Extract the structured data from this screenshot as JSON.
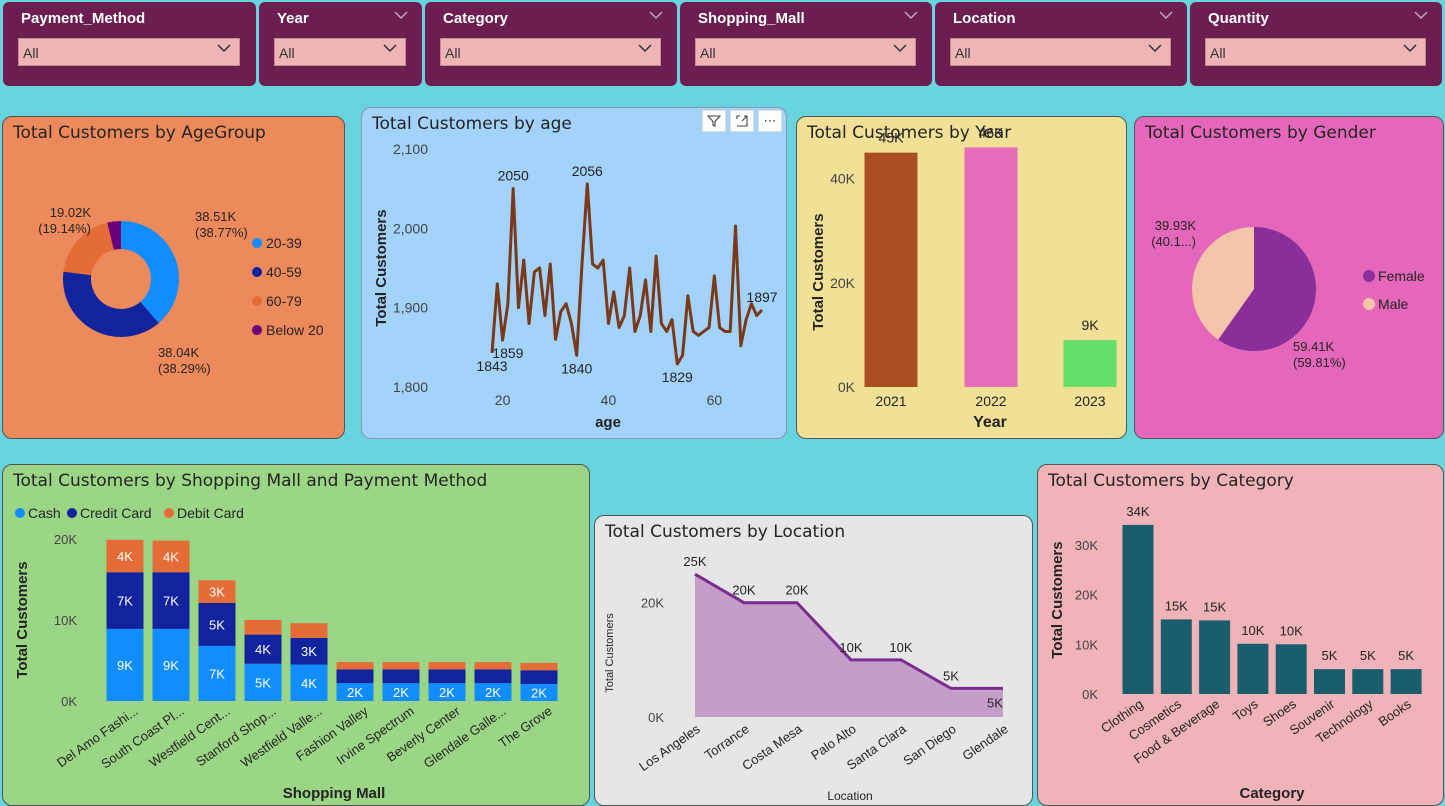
{
  "slicers": [
    {
      "title": "Payment_Method",
      "value": "All"
    },
    {
      "title": "Year",
      "value": "All"
    },
    {
      "title": "Category",
      "value": "All"
    },
    {
      "title": "Shopping_Mall",
      "value": "All"
    },
    {
      "title": "Location",
      "value": "All"
    },
    {
      "title": "Quantity",
      "value": "All"
    }
  ],
  "visual_header": {
    "filter_icon": "filter-icon",
    "focus_icon": "focus-mode-icon",
    "more_icon": "more-options-icon",
    "more_glyph": "⋯"
  },
  "chart_data": [
    {
      "id": "agegroup",
      "type": "pie",
      "title": "Total Customers by AgeGroup",
      "donut": true,
      "categories": [
        "20-39",
        "40-59",
        "60-79",
        "Below 20"
      ],
      "values": [
        38510,
        38040,
        19020,
        3800
      ],
      "colors": [
        "#118dff",
        "#12239e",
        "#e66c37",
        "#6b007b"
      ],
      "labels": [
        {
          "v": "38.51K",
          "p": "(38.77%)"
        },
        {
          "v": "38.04K",
          "p": "(38.29%)"
        },
        {
          "v": "19.02K",
          "p": "(19.14%)"
        }
      ],
      "legend_position": "right"
    },
    {
      "id": "age",
      "type": "line",
      "title": "Total Customers by age",
      "xlabel": "age",
      "ylabel": "Total Customers",
      "x": [
        18,
        19,
        20,
        21,
        22,
        23,
        24,
        25,
        26,
        27,
        28,
        29,
        30,
        31,
        32,
        33,
        34,
        35,
        36,
        37,
        38,
        39,
        40,
        41,
        42,
        43,
        44,
        45,
        46,
        47,
        48,
        49,
        50,
        51,
        52,
        53,
        54,
        55,
        56,
        57,
        58,
        59,
        60,
        61,
        62,
        63,
        64,
        65,
        66,
        67,
        68,
        69
      ],
      "y": [
        1843,
        1930,
        1859,
        1905,
        2050,
        1900,
        1960,
        1880,
        1945,
        1950,
        1890,
        1955,
        1860,
        1895,
        1905,
        1880,
        1840,
        1955,
        2056,
        1955,
        1950,
        1960,
        1880,
        1920,
        1875,
        1890,
        1950,
        1870,
        1890,
        1935,
        1870,
        1965,
        1880,
        1870,
        1885,
        1829,
        1840,
        1915,
        1870,
        1865,
        1870,
        1875,
        1940,
        1875,
        1870,
        1870,
        2003,
        1852,
        1885,
        1905,
        1890,
        1897
      ],
      "xticks": [
        20,
        40,
        60
      ],
      "yticks": [
        1800,
        1900,
        2000,
        2100
      ],
      "ytick_labels": [
        "1,800",
        "1,900",
        "2,000",
        "2,100"
      ],
      "ylim": [
        1800,
        2100
      ],
      "color": "#7a3a1a",
      "annotations": [
        {
          "x": 18,
          "y": 1843,
          "label": "1843",
          "pos": "below"
        },
        {
          "x": 22,
          "y": 2050,
          "label": "2050",
          "pos": "above"
        },
        {
          "x": 21,
          "y": 1859,
          "label": "1859",
          "pos": "below"
        },
        {
          "x": 34,
          "y": 1840,
          "label": "1840",
          "pos": "below"
        },
        {
          "x": 36,
          "y": 2056,
          "label": "2056",
          "pos": "above"
        },
        {
          "x": 53,
          "y": 1829,
          "label": "1829",
          "pos": "below"
        },
        {
          "x": 69,
          "y": 1897,
          "label": "1897",
          "pos": "above"
        }
      ]
    },
    {
      "id": "year",
      "type": "bar",
      "title": "Total Customers by Year",
      "xlabel": "Year",
      "ylabel": "Total Customers",
      "categories": [
        "2021",
        "2022",
        "2023"
      ],
      "values": [
        45000,
        46000,
        9000
      ],
      "value_labels": [
        "45K",
        "46K",
        "9K"
      ],
      "colors": [
        "#a94f22",
        "#e66bba",
        "#66de6a"
      ],
      "yticks": [
        0,
        20000,
        40000
      ],
      "ytick_labels": [
        "0K",
        "20K",
        "40K"
      ],
      "ylim": [
        0,
        48000
      ]
    },
    {
      "id": "gender",
      "type": "pie",
      "title": "Total Customers by Gender",
      "categories": [
        "Female",
        "Male"
      ],
      "values": [
        59410,
        39930
      ],
      "colors": [
        "#8a2f9a",
        "#f4c5ab"
      ],
      "labels": [
        {
          "v": "59.41K",
          "p": "(59.81%)"
        },
        {
          "v": "39.93K",
          "p": "(40.1...)"
        }
      ],
      "legend_position": "right"
    },
    {
      "id": "mall",
      "type": "bar",
      "stacked": true,
      "title": "Total Customers by Shopping Mall and Payment Method",
      "xlabel": "Shopping Mall",
      "ylabel": "Total Customers",
      "categories": [
        "Del Amo Fashi...",
        "South Coast Pl...",
        "Westfield Cent...",
        "Stanford Shop...",
        "Westfield Valle...",
        "Fashion Valley",
        "Irvine Spectrum",
        "Beverly Center",
        "Glendale Galle...",
        "The Grove"
      ],
      "series": [
        {
          "name": "Cash",
          "color": "#118dff",
          "values": [
            8900,
            8900,
            6800,
            4600,
            4500,
            2200,
            2200,
            2200,
            2200,
            2100
          ],
          "labels": [
            "9K",
            "9K",
            "7K",
            "5K",
            "4K",
            "2K",
            "2K",
            "2K",
            "2K",
            "2K"
          ]
        },
        {
          "name": "Credit Card",
          "color": "#12239e",
          "values": [
            7000,
            7000,
            5300,
            3600,
            3300,
            1700,
            1700,
            1700,
            1700,
            1700
          ],
          "labels": [
            "7K",
            "7K",
            "5K",
            "4K",
            "3K",
            "",
            "",
            "",
            "",
            ""
          ]
        },
        {
          "name": "Debit Card",
          "color": "#e66c37",
          "values": [
            4000,
            3900,
            2800,
            1800,
            1800,
            900,
            900,
            900,
            900,
            900
          ],
          "labels": [
            "4K",
            "4K",
            "3K",
            "",
            "",
            "",
            "",
            "",
            "",
            ""
          ]
        }
      ],
      "yticks": [
        0,
        10000,
        20000
      ],
      "ytick_labels": [
        "0K",
        "10K",
        "20K"
      ],
      "ylim": [
        0,
        20000
      ],
      "legend_position": "top-left"
    },
    {
      "id": "location",
      "type": "area",
      "title": "Total Customers by Location",
      "xlabel": "Location",
      "ylabel": "Total Customers",
      "categories": [
        "Los Angeles",
        "Torrance",
        "Costa Mesa",
        "Palo Alto",
        "Santa Clara",
        "San Diego",
        "Glendale"
      ],
      "values": [
        25000,
        20000,
        20000,
        10000,
        10000,
        5000,
        5000
      ],
      "value_labels": [
        "25K",
        "20K",
        "20K",
        "10K",
        "10K",
        "5K",
        "5K"
      ],
      "yticks": [
        0,
        20000
      ],
      "ytick_labels": [
        "0K",
        "20K"
      ],
      "ylim": [
        0,
        28000
      ],
      "line_color": "#7b2c8f",
      "fill_color": "#c49dc9"
    },
    {
      "id": "category",
      "type": "bar",
      "title": "Total Customers by Category",
      "xlabel": "Category",
      "ylabel": "Total Customers",
      "categories": [
        "Clothing",
        "Cosmetics",
        "Food & Beverage",
        "Toys",
        "Shoes",
        "Souvenir",
        "Technology",
        "Books"
      ],
      "values": [
        34000,
        15000,
        14800,
        10100,
        10000,
        5000,
        5000,
        5000
      ],
      "value_labels": [
        "34K",
        "15K",
        "15K",
        "10K",
        "10K",
        "5K",
        "5K",
        "5K"
      ],
      "color": "#1a5e6e",
      "yticks": [
        0,
        10000,
        20000,
        30000
      ],
      "ytick_labels": [
        "0K",
        "10K",
        "20K",
        "30K"
      ],
      "ylim": [
        0,
        38000
      ]
    }
  ]
}
